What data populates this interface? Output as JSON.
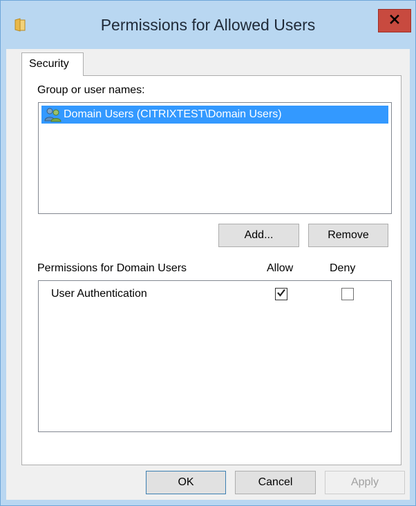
{
  "window": {
    "title": "Permissions for Allowed Users",
    "title_icon": "folder-icon",
    "close_label": "x"
  },
  "tabs": [
    {
      "label": "Security",
      "selected": true
    }
  ],
  "security": {
    "group_label": "Group or user names:",
    "users": [
      {
        "name": "Domain Users (CITRIXTEST\\Domain Users)",
        "icon": "user-group-icon",
        "selected": true
      }
    ],
    "add_label": "Add...",
    "remove_label": "Remove",
    "permissions_label": "Permissions for Domain Users",
    "allow_header": "Allow",
    "deny_header": "Deny",
    "permissions": [
      {
        "name": "User Authentication",
        "allow": true,
        "deny": false
      }
    ]
  },
  "footer": {
    "ok_label": "OK",
    "cancel_label": "Cancel",
    "apply_label": "Apply"
  },
  "colors": {
    "title_bar": "#b9d7f1",
    "selection": "#3399ff",
    "close_button": "#c84a3f"
  }
}
